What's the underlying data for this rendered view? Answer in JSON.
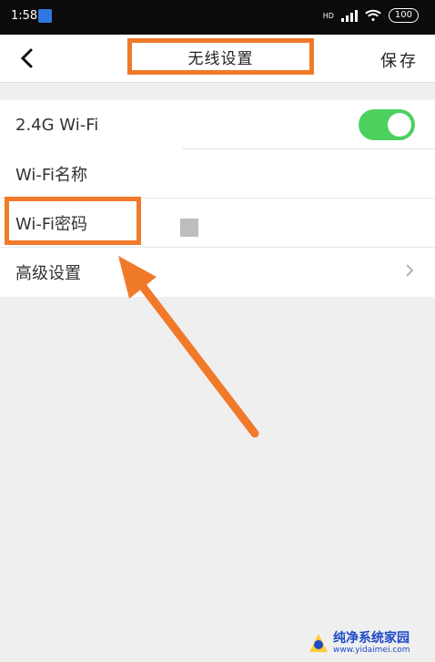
{
  "status_bar": {
    "time": "1:58",
    "battery": "100",
    "network_label": "HD",
    "colors": {
      "background": "#0b0b0b"
    }
  },
  "header": {
    "title": "无线设置",
    "save_label": "保存"
  },
  "settings": [
    {
      "label": "2.4G Wi-Fi",
      "toggle": true
    },
    {
      "label": "Wi-Fi名称"
    },
    {
      "label": "Wi-Fi密码",
      "value_masked": true
    },
    {
      "label": "高级设置",
      "chevron": true
    }
  ],
  "watermark": {
    "title": "纯净系统家园",
    "url": "www.yidaimei.com"
  },
  "colors": {
    "accent": "#f07a2a",
    "toggle_on": "#4cd15f",
    "watermark": "#1d49c7"
  }
}
